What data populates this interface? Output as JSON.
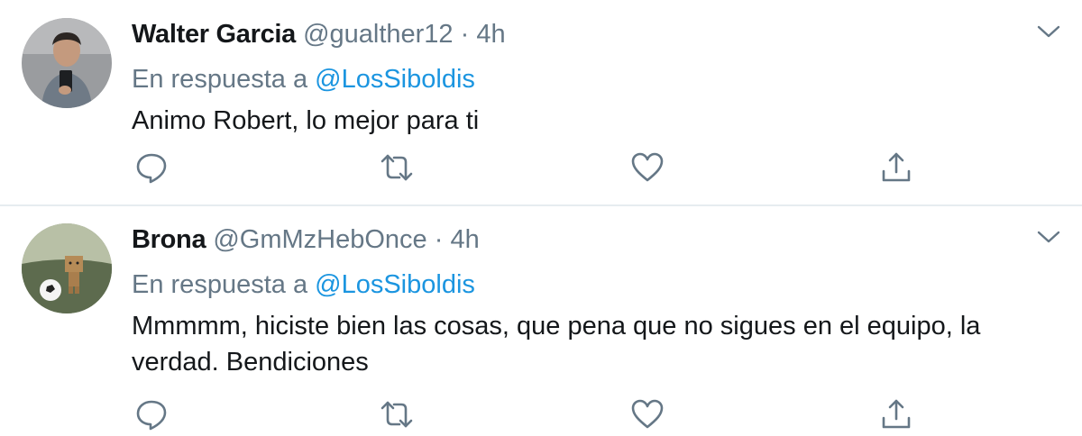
{
  "tweets": [
    {
      "name": "Walter Garcia",
      "handle": "@gualther12",
      "separator": "·",
      "time": "4h",
      "reply_prefix": "En respuesta a",
      "reply_mention": "@LosSiboldis",
      "text": "Animo Robert, lo mejor para ti",
      "icons": [
        "reply-icon",
        "retweet-icon",
        "like-icon",
        "share-icon",
        "chevron-down-icon"
      ]
    },
    {
      "name": "Brona",
      "handle": "@GmMzHebOnce",
      "separator": "·",
      "time": "4h",
      "reply_prefix": "En respuesta a",
      "reply_mention": "@LosSiboldis",
      "text": "Mmmmm, hiciste bien las cosas, que pena que no sigues en el equipo, la verdad. Bendiciones",
      "icons": [
        "reply-icon",
        "retweet-icon",
        "like-icon",
        "share-icon",
        "chevron-down-icon"
      ]
    }
  ],
  "colors": {
    "text_primary": "#14171a",
    "text_secondary": "#657786",
    "link": "#1b95e0",
    "divider": "#e6ecf0"
  }
}
